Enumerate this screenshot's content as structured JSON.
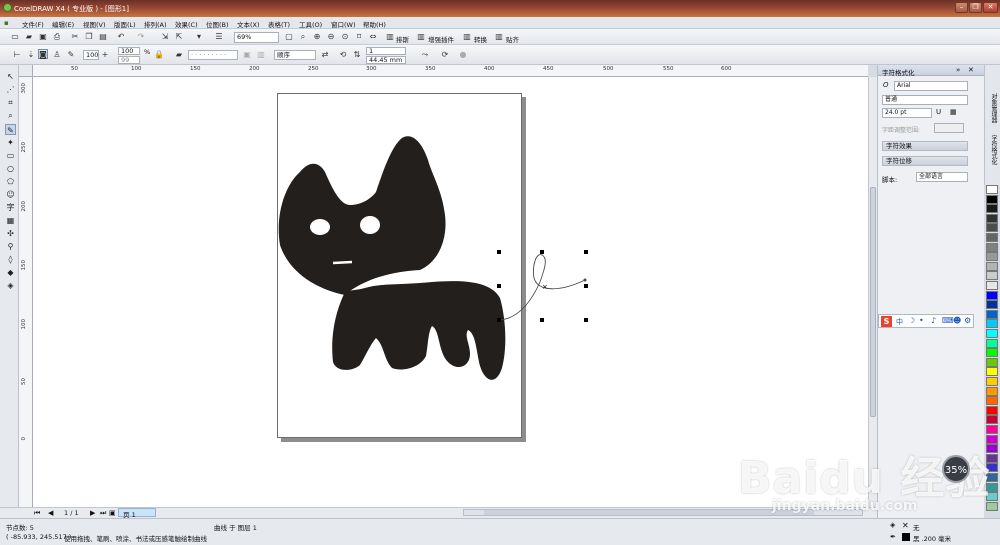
{
  "window": {
    "title": "CorelDRAW X4 ( 专业版 ) - [图形1]"
  },
  "menu": [
    "文件(F)",
    "编辑(E)",
    "视图(V)",
    "版面(L)",
    "排列(A)",
    "效果(C)",
    "位图(B)",
    "文本(X)",
    "表格(T)",
    "工具(O)",
    "窗口(W)",
    "帮助(H)"
  ],
  "toolbar1": {
    "zoom": "69%",
    "btn_arrange": "排斯",
    "btn_enhance": "增强插件",
    "btn_convert": "转换",
    "btn_paste": "贴齐"
  },
  "toolbar2": {
    "val_100": "100",
    "scale_w": "100",
    "scale_h": "99",
    "pct": "%",
    "outline_order": "顺序",
    "pos_val": "1",
    "size_val": "44.45 mm"
  },
  "ruler": {
    "h_ticks": [
      "50",
      "100",
      "150",
      "200",
      "250",
      "300",
      "350",
      "400",
      "450",
      "500",
      "550",
      "600"
    ],
    "v_ticks": [
      "300",
      "250",
      "200",
      "150",
      "100",
      "50",
      "0"
    ]
  },
  "page_nav": {
    "counter": "1 / 1",
    "tab": "页 1"
  },
  "status": {
    "nodes": "节点数: 5",
    "object": "曲线 于 图层 1",
    "coords": "( -85.933, 245.517 )",
    "hint": "使用拖拽、笔刷、喷涂、书法或压感笔触绘制曲线",
    "fill_label": "无",
    "outline_label": "黑  .200 毫米"
  },
  "docker": {
    "title": "字符格式化",
    "font": "Arial",
    "style": "普通",
    "size": "24.0 pt",
    "kerning_label": "字距调整范围:",
    "effects": "字符效果",
    "offset": "字符位移",
    "script_label": "脚本:",
    "script_value": "全部语言",
    "side_tabs": [
      "对象管理器",
      "字符格式化"
    ]
  },
  "ime": {
    "label": "中"
  },
  "badge": {
    "value": "35%"
  },
  "watermark": {
    "main": "Baidu 经验",
    "sub": "jingyan.baidu.com"
  },
  "palette_colors": [
    "#ffffff",
    "#000000",
    "#1a1a1a",
    "#333333",
    "#4d4d4d",
    "#666666",
    "#808080",
    "#999999",
    "#b3b3b3",
    "#cccccc",
    "#e6e6e6",
    "#0000ff",
    "#003399",
    "#0066cc",
    "#00ccff",
    "#00ffff",
    "#00ff99",
    "#00ff00",
    "#66cc00",
    "#ffff00",
    "#ffcc00",
    "#ff9900",
    "#ff6600",
    "#ff0000",
    "#cc0033",
    "#ff0099",
    "#cc00cc",
    "#9900cc",
    "#663399",
    "#3333cc",
    "#336699",
    "#339999",
    "#66cccc",
    "#99cc99"
  ]
}
